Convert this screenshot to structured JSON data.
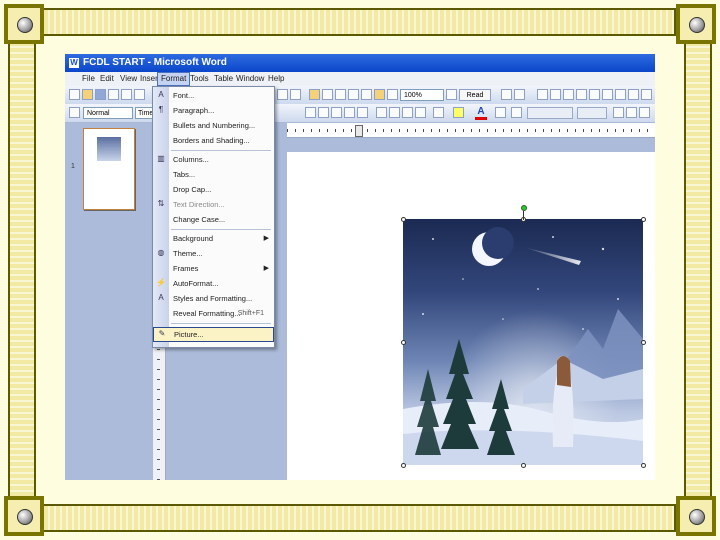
{
  "window": {
    "title": "FCDL START - Microsoft Word"
  },
  "menubar": {
    "items": [
      "File",
      "Edit",
      "View",
      "Insert",
      "Format",
      "Tools",
      "Table",
      "Window",
      "Help"
    ],
    "active": "Format"
  },
  "toolbar": {
    "zoom": "100%",
    "read_label": "Read",
    "style": "Normal",
    "font": "Times"
  },
  "thumbnail": {
    "page_number": "1"
  },
  "format_menu": {
    "items": [
      {
        "label": "Font...",
        "enabled": true
      },
      {
        "label": "Paragraph...",
        "enabled": true
      },
      {
        "label": "Bullets and Numbering...",
        "enabled": true
      },
      {
        "label": "Borders and Shading...",
        "enabled": true
      },
      {
        "label": "Columns...",
        "enabled": true
      },
      {
        "label": "Tabs...",
        "enabled": true
      },
      {
        "label": "Drop Cap...",
        "enabled": true
      },
      {
        "label": "Text Direction...",
        "enabled": false
      },
      {
        "label": "Change Case...",
        "enabled": true
      },
      {
        "label": "Background",
        "enabled": true,
        "submenu": true
      },
      {
        "label": "Theme...",
        "enabled": true
      },
      {
        "label": "Frames",
        "enabled": true,
        "submenu": true
      },
      {
        "label": "AutoFormat...",
        "enabled": true
      },
      {
        "label": "Styles and Formatting...",
        "enabled": true
      },
      {
        "label": "Reveal Formatting...",
        "enabled": true,
        "shortcut": "Shift+F1"
      },
      {
        "label": "Picture...",
        "enabled": true,
        "highlighted": true
      }
    ]
  },
  "colors": {
    "titlebar": "#0a46c8",
    "frame": "#f2eaa2",
    "menu_highlight": "#fbf3c6"
  }
}
